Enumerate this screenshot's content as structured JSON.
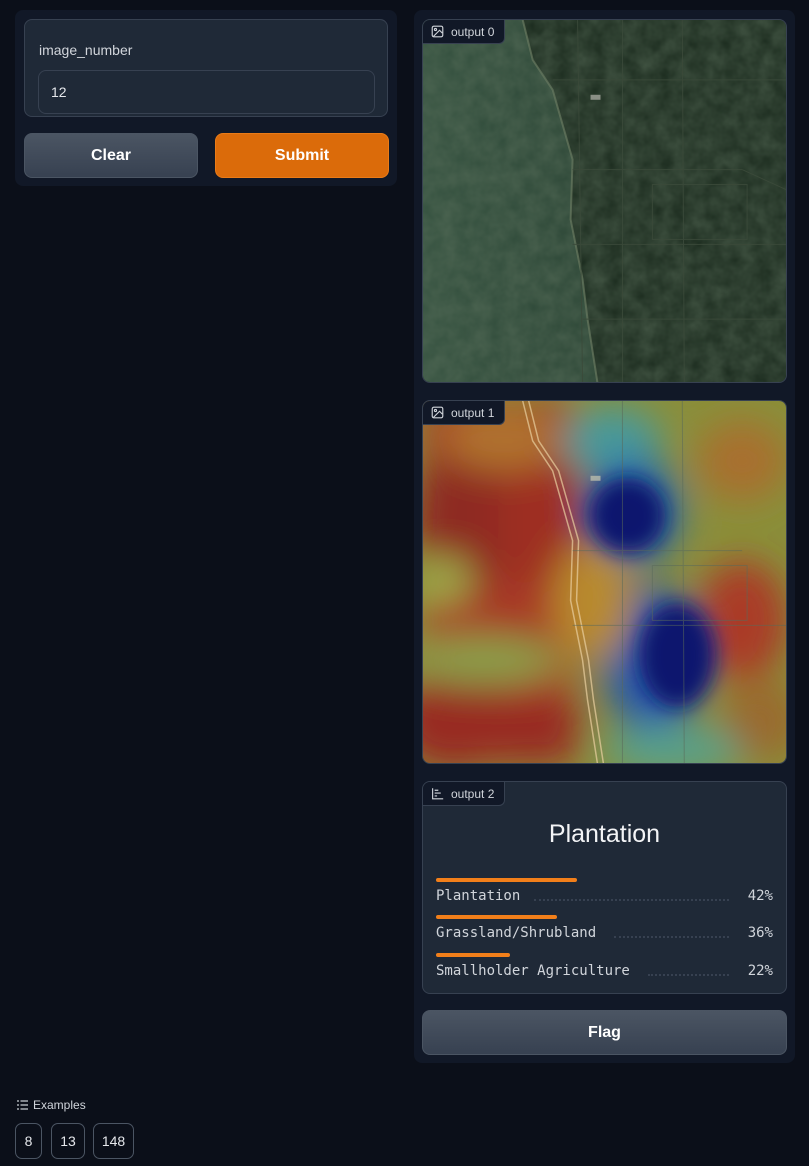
{
  "inputs": {
    "image_number_label": "image_number",
    "image_number_value": "12"
  },
  "actions": {
    "clear_label": "Clear",
    "submit_label": "Submit",
    "flag_label": "Flag"
  },
  "outputs": {
    "output0_label": "output 0",
    "output1_label": "output 1",
    "output2_label": "output 2"
  },
  "classification": {
    "top_label": "Plantation",
    "confidences": [
      {
        "label": "Plantation",
        "value": "42%",
        "fraction": 0.42
      },
      {
        "label": "Grassland/Shrubland",
        "value": "36%",
        "fraction": 0.36
      },
      {
        "label": "Smallholder Agriculture",
        "value": "22%",
        "fraction": 0.22
      }
    ]
  },
  "examples": {
    "header": "Examples",
    "items": [
      "8",
      "13",
      "148"
    ]
  },
  "colors": {
    "accent": "#db6b0a",
    "bar": "#f27f1a",
    "background": "#0b0f19"
  }
}
